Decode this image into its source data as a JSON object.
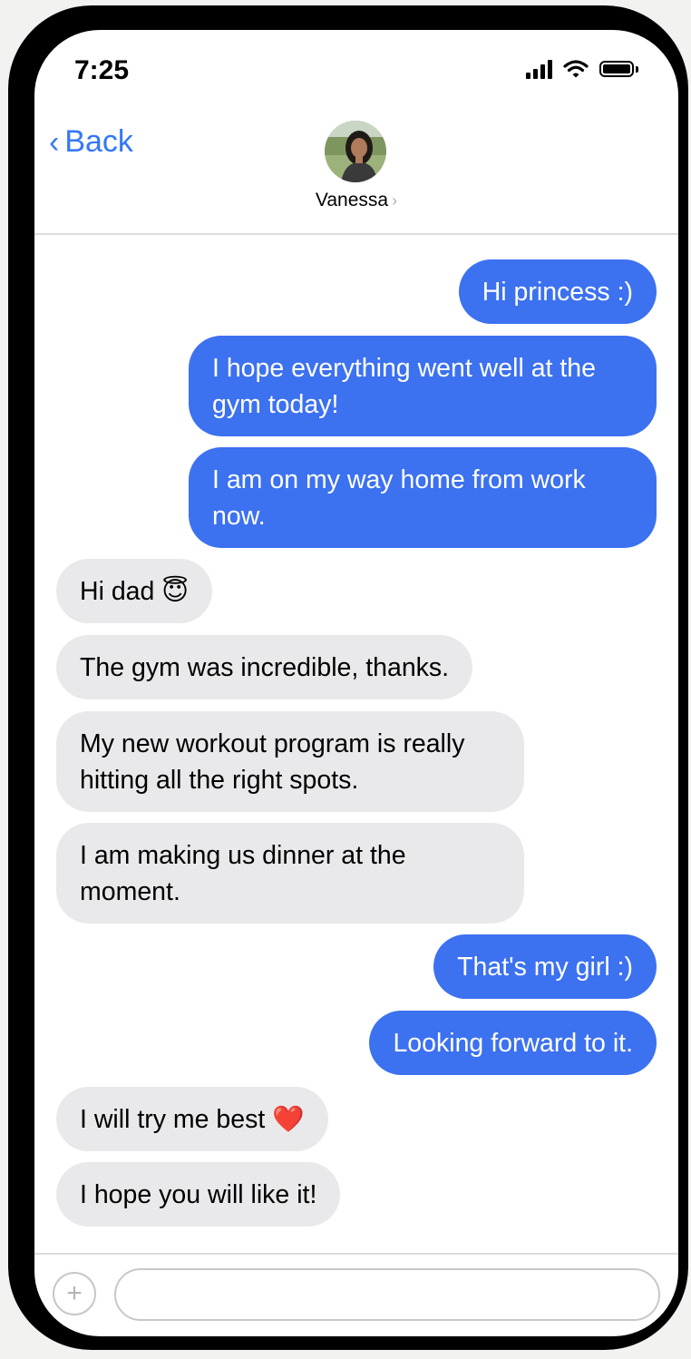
{
  "status_bar": {
    "time": "7:25",
    "icons": [
      "cellular-signal-icon",
      "wifi-icon",
      "battery-icon"
    ]
  },
  "header": {
    "back_label": "Back",
    "back_chevron": "‹",
    "contact_name": "Vanessa",
    "name_chevron": "›"
  },
  "colors": {
    "accent": "#3478f6",
    "sent_bubble": "#3c71f0",
    "received_bubble": "#e9e9eb"
  },
  "messages": [
    {
      "direction": "sent",
      "text": "Hi princess :)"
    },
    {
      "direction": "sent",
      "text": "I hope everything went well at the gym today!"
    },
    {
      "direction": "sent",
      "text": "I am on my way home from work now."
    },
    {
      "direction": "received",
      "text": "Hi dad 😇"
    },
    {
      "direction": "received",
      "text": "The gym was incredible, thanks."
    },
    {
      "direction": "received",
      "text": "My new workout program is really hitting all the right spots."
    },
    {
      "direction": "received",
      "text": "I am making us dinner at the moment."
    },
    {
      "direction": "sent",
      "text": "That's my girl :)"
    },
    {
      "direction": "sent",
      "text": "Looking forward to it."
    },
    {
      "direction": "received",
      "text": "I will try me best ❤️"
    },
    {
      "direction": "received",
      "text": "I hope you will like it!"
    }
  ],
  "composer": {
    "plus_label": "+",
    "input_value": "",
    "input_placeholder": ""
  }
}
